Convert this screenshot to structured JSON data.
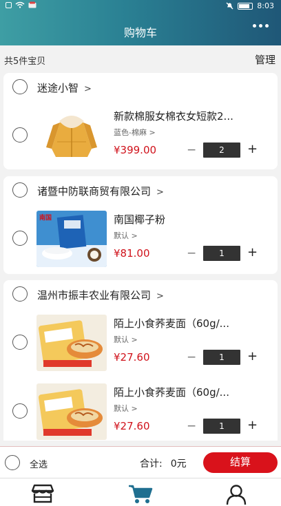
{
  "status": {
    "time": "8:03"
  },
  "header": {
    "title": "购物车",
    "more_icon": "more-dots-icon"
  },
  "summary": {
    "count_text": "共5件宝贝",
    "manage_label": "管理"
  },
  "shops": [
    {
      "name": "迷途小智",
      "items": [
        {
          "name": "新款棉服女棉衣女短款2...",
          "spec": "蓝色-棉麻",
          "price": "¥399.00",
          "qty": "2"
        }
      ]
    },
    {
      "name": "诸暨中防联商贸有限公司",
      "items": [
        {
          "name": "南国椰子粉",
          "spec": "默认",
          "price": "¥81.00",
          "qty": "1",
          "brand": "南国"
        }
      ]
    },
    {
      "name": "温州市振丰农业有限公司",
      "items": [
        {
          "name": "陌上小食荞麦面（60g/...",
          "spec": "默认",
          "price": "¥27.60",
          "qty": "1"
        },
        {
          "name": "陌上小食荞麦面（60g/...",
          "spec": "默认",
          "price": "¥27.60",
          "qty": "1"
        }
      ]
    }
  ],
  "icons": {
    "chevron": ">",
    "minus": "−",
    "plus": "+"
  },
  "footer": {
    "select_all": "全选",
    "total_label": "合计:",
    "total_value": "0元",
    "checkout_label": "结算"
  },
  "tabbar": [
    {
      "icon": "shop-icon"
    },
    {
      "icon": "cart-icon"
    },
    {
      "icon": "user-icon"
    }
  ],
  "colors": {
    "accent": "#d9121b",
    "header_start": "#3e9ea4",
    "header_end": "#1f5777",
    "cart_tab": "#1f6f90"
  }
}
